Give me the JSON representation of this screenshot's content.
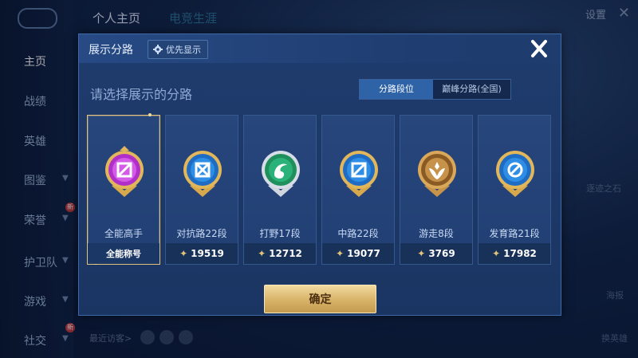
{
  "background": {
    "top_tabs": [
      "个人主页",
      "电竞生涯"
    ],
    "settings_label": "设置",
    "sidebar_items": [
      {
        "label": "主页",
        "active": true
      },
      {
        "label": "战绩"
      },
      {
        "label": "英雄"
      },
      {
        "label": "图鉴"
      },
      {
        "label": "荣誉"
      },
      {
        "label": "护卫队"
      },
      {
        "label": "游戏"
      },
      {
        "label": "社交"
      }
    ],
    "new_badge": "新",
    "recent_visitors": "最近访客>",
    "right_labels": [
      "逐迹之石",
      "海报",
      "换英雄"
    ]
  },
  "modal": {
    "title": "展示分路",
    "pref_button": "优先显示",
    "subtitle": "请选择展示的分路",
    "segment": {
      "left": "分路段位",
      "right": "巅峰分路(全国)"
    },
    "cards": [
      {
        "title": "全能高手",
        "footer": "全能称号",
        "badge_color": "#b02fc8",
        "selected": true
      },
      {
        "title": "对抗路22段",
        "footer": "19519",
        "badge_color": "#2e8ee6"
      },
      {
        "title": "打野17段",
        "footer": "12712",
        "badge_color": "#2bb27a"
      },
      {
        "title": "中路22段",
        "footer": "19077",
        "badge_color": "#2e8ee6"
      },
      {
        "title": "游走8段",
        "footer": "3769",
        "badge_color": "#c7934a"
      },
      {
        "title": "发育路21段",
        "footer": "17982",
        "badge_color": "#2e8ee6"
      }
    ],
    "confirm_button": "确定",
    "colors": {
      "accent_gold": "#d9b66b",
      "panel": "#1f3c6e",
      "selected_border": "#e0c27a"
    }
  }
}
